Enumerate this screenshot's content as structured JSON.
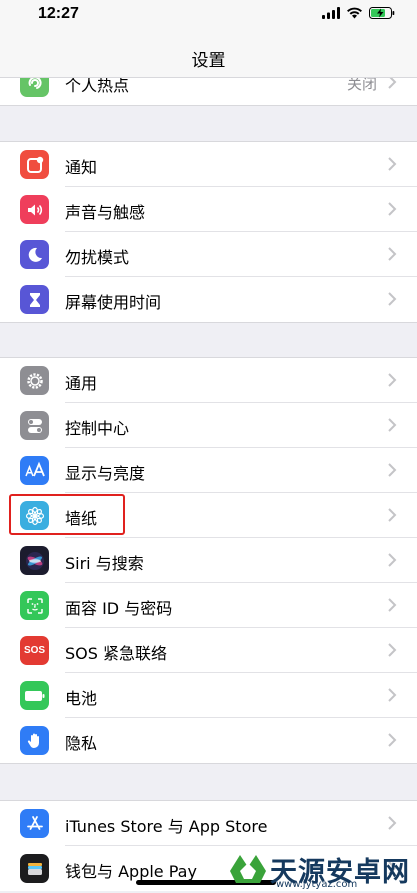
{
  "status": {
    "time": "12:27"
  },
  "nav": {
    "title": "设置"
  },
  "groups": [
    {
      "items": [
        {
          "label": "个人热点",
          "value": "关闭",
          "icon": "hotspot-icon",
          "color": "#65c466"
        }
      ]
    },
    {
      "items": [
        {
          "label": "通知",
          "icon": "notification-icon",
          "color": "#f04d3f"
        },
        {
          "label": "声音与触感",
          "icon": "speaker-icon",
          "color": "#ef3e5b"
        },
        {
          "label": "勿扰模式",
          "icon": "moon-icon",
          "color": "#5856d6"
        },
        {
          "label": "屏幕使用时间",
          "icon": "hourglass-icon",
          "color": "#5856d6"
        }
      ]
    },
    {
      "items": [
        {
          "label": "通用",
          "icon": "gear-icon",
          "color": "#8e8e93"
        },
        {
          "label": "控制中心",
          "icon": "toggles-icon",
          "color": "#8e8e93"
        },
        {
          "label": "显示与亮度",
          "icon": "text-size-icon",
          "color": "#2f7cf6"
        },
        {
          "label": "墙纸",
          "icon": "flower-icon",
          "color": "#3aaee0"
        },
        {
          "label": "Siri 与搜索",
          "icon": "siri-icon",
          "color": "#1c1c2e"
        },
        {
          "label": "面容 ID 与密码",
          "icon": "face-id-icon",
          "color": "#34c759"
        },
        {
          "label": "SOS 紧急联络",
          "icon": "sos-icon",
          "color": "#e33a32",
          "icon_text": "SOS"
        },
        {
          "label": "电池",
          "icon": "battery-icon",
          "color": "#34c759"
        },
        {
          "label": "隐私",
          "icon": "hand-icon",
          "color": "#2f7cf6"
        }
      ]
    },
    {
      "items": [
        {
          "label": "iTunes Store 与 App Store",
          "icon": "app-store-icon",
          "color": "#2f7cf6"
        },
        {
          "label": "钱包与 Apple Pay",
          "icon": "wallet-icon",
          "color": "#1c1c1e"
        }
      ]
    }
  ],
  "watermark": {
    "main": "天源安卓网",
    "sub": "www.jytyaz.com"
  }
}
